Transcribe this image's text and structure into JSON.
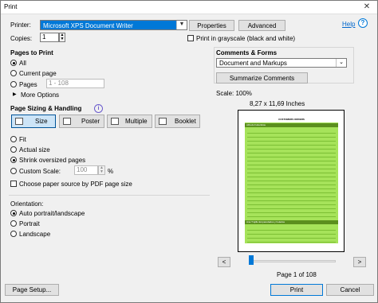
{
  "window": {
    "title": "Print",
    "close": "✕"
  },
  "printer": {
    "label": "Printer:",
    "value": "Microsoft XPS Document Writer",
    "properties": "Properties",
    "advanced": "Advanced",
    "help": "Help"
  },
  "copies": {
    "label": "Copies:",
    "value": "1",
    "grayscale_label": "Print in grayscale (black and white)"
  },
  "pages": {
    "title": "Pages to Print",
    "all": "All",
    "current": "Current page",
    "pages": "Pages",
    "range_value": "1 - 108",
    "more": "More Options"
  },
  "sizing": {
    "title": "Page Sizing & Handling",
    "modes": [
      "Size",
      "Poster",
      "Multiple",
      "Booklet"
    ],
    "fit": "Fit",
    "actual": "Actual size",
    "shrink": "Shrink oversized pages",
    "custom": "Custom Scale:",
    "scale_value": "100",
    "percent": "%",
    "paper_source": "Choose paper source by PDF page size"
  },
  "orientation": {
    "title": "Orientation:",
    "auto": "Auto portrait/landscape",
    "portrait": "Portrait",
    "landscape": "Landscape"
  },
  "comments": {
    "title": "Comments & Forms",
    "value": "Document and Markups",
    "summarize": "Summarize Comments"
  },
  "preview": {
    "scale": "Scale: 100%",
    "size": "8,27 x 11,69 Inches",
    "page_label": "Page 1 of 108",
    "prev": "<",
    "next": ">",
    "doc_header": "CUSTOMERS ORDERS",
    "section1": "Alfreds Futterkiste",
    "section2": "Ana Trujillo Emparedados y helados"
  },
  "footer": {
    "page_setup": "Page Setup...",
    "print": "Print",
    "cancel": "Cancel"
  },
  "colors": {
    "accent": "#0078d7",
    "preview_green": "#a6e35a",
    "preview_dark": "#5b8f1e"
  }
}
